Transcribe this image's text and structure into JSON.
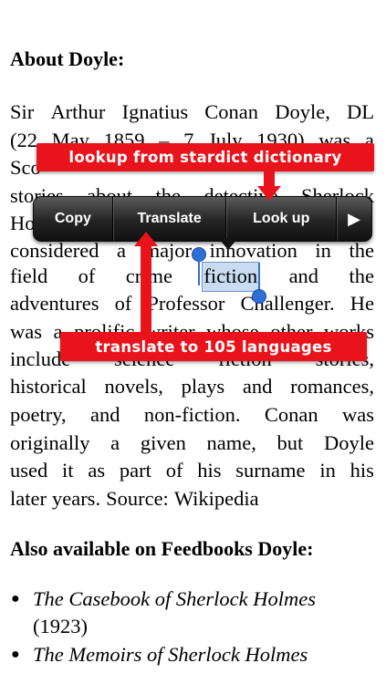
{
  "about": {
    "heading": "About Doyle:",
    "lines": [
      [
        "Sir",
        "Arthur",
        "Ignatius",
        "Conan",
        "Doyle,",
        "DL"
      ],
      [
        "(22",
        "May",
        "1859",
        "–",
        "7",
        "July",
        "1930)",
        "was",
        "a"
      ],
      [
        "Sco"
      ],
      [
        "stories",
        "about",
        "the",
        "detective",
        "Sherlock"
      ],
      [
        "Ho"
      ],
      [
        "considered",
        "a",
        "major",
        "innovation",
        "in",
        "the"
      ],
      [
        "field",
        "of",
        "crime",
        "fiction",
        "and",
        "the"
      ],
      [
        "adventures",
        "of",
        "Professor",
        "Challenger.",
        "He"
      ],
      [
        "was",
        "a",
        "prolific",
        "writer",
        "whose",
        "other",
        "works"
      ],
      [
        "include",
        "science",
        "fiction",
        "stories,"
      ],
      [
        "historical",
        "novels,",
        "plays",
        "and",
        "romances,"
      ],
      [
        "poetry,",
        "and",
        "non-fiction.",
        "Conan",
        "was"
      ],
      [
        "originally",
        "a",
        "given",
        "name,",
        "but",
        "Doyle"
      ],
      [
        "used",
        "it",
        "as",
        "part",
        "of",
        "his",
        "surname",
        "in",
        "his"
      ],
      [
        "later",
        "years.",
        "Source:",
        "Wikipedia"
      ]
    ],
    "selected_word": "fiction"
  },
  "context_menu": {
    "copy": "Copy",
    "translate": "Translate",
    "lookup": "Look up",
    "more": "▶"
  },
  "callouts": {
    "lookup": "lookup from stardict dictionary",
    "translate": "translate to 105 languages"
  },
  "also_available": {
    "heading": "Also available on Feedbooks Doyle:",
    "items": [
      {
        "title": "The Casebook of Sherlock Holmes",
        "year": "(1923)"
      },
      {
        "title": "The Memoirs of Sherlock Holmes",
        "year": ""
      }
    ]
  },
  "colors": {
    "callout_red": "#e8131b",
    "selection_blue": "#c9dcf2",
    "handle_blue": "#2f6fd6",
    "menu_dark": "#242424"
  }
}
